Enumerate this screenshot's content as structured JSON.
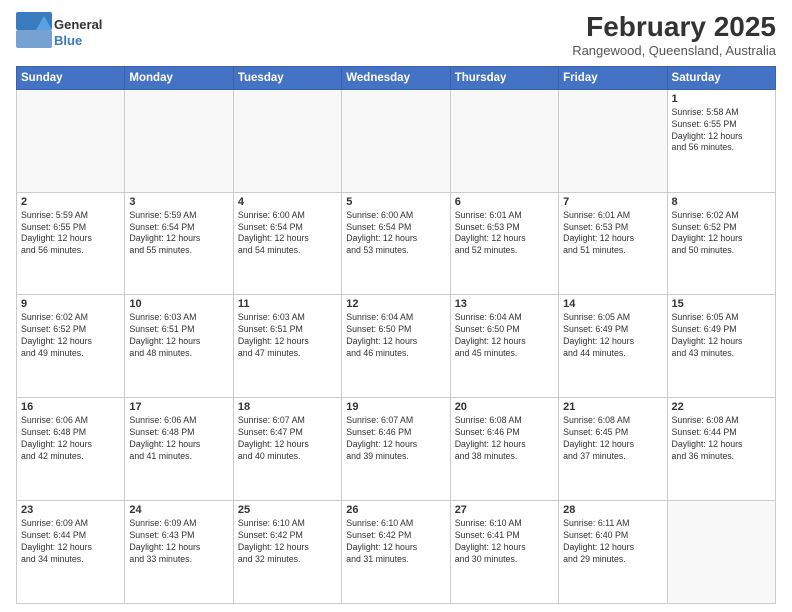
{
  "logo": {
    "general": "General",
    "blue": "Blue"
  },
  "header": {
    "month": "February 2025",
    "location": "Rangewood, Queensland, Australia"
  },
  "days_of_week": [
    "Sunday",
    "Monday",
    "Tuesday",
    "Wednesday",
    "Thursday",
    "Friday",
    "Saturday"
  ],
  "weeks": [
    [
      {
        "day": "",
        "info": ""
      },
      {
        "day": "",
        "info": ""
      },
      {
        "day": "",
        "info": ""
      },
      {
        "day": "",
        "info": ""
      },
      {
        "day": "",
        "info": ""
      },
      {
        "day": "",
        "info": ""
      },
      {
        "day": "1",
        "info": "Sunrise: 5:58 AM\nSunset: 6:55 PM\nDaylight: 12 hours\nand 56 minutes."
      }
    ],
    [
      {
        "day": "2",
        "info": "Sunrise: 5:59 AM\nSunset: 6:55 PM\nDaylight: 12 hours\nand 56 minutes."
      },
      {
        "day": "3",
        "info": "Sunrise: 5:59 AM\nSunset: 6:54 PM\nDaylight: 12 hours\nand 55 minutes."
      },
      {
        "day": "4",
        "info": "Sunrise: 6:00 AM\nSunset: 6:54 PM\nDaylight: 12 hours\nand 54 minutes."
      },
      {
        "day": "5",
        "info": "Sunrise: 6:00 AM\nSunset: 6:54 PM\nDaylight: 12 hours\nand 53 minutes."
      },
      {
        "day": "6",
        "info": "Sunrise: 6:01 AM\nSunset: 6:53 PM\nDaylight: 12 hours\nand 52 minutes."
      },
      {
        "day": "7",
        "info": "Sunrise: 6:01 AM\nSunset: 6:53 PM\nDaylight: 12 hours\nand 51 minutes."
      },
      {
        "day": "8",
        "info": "Sunrise: 6:02 AM\nSunset: 6:52 PM\nDaylight: 12 hours\nand 50 minutes."
      }
    ],
    [
      {
        "day": "9",
        "info": "Sunrise: 6:02 AM\nSunset: 6:52 PM\nDaylight: 12 hours\nand 49 minutes."
      },
      {
        "day": "10",
        "info": "Sunrise: 6:03 AM\nSunset: 6:51 PM\nDaylight: 12 hours\nand 48 minutes."
      },
      {
        "day": "11",
        "info": "Sunrise: 6:03 AM\nSunset: 6:51 PM\nDaylight: 12 hours\nand 47 minutes."
      },
      {
        "day": "12",
        "info": "Sunrise: 6:04 AM\nSunset: 6:50 PM\nDaylight: 12 hours\nand 46 minutes."
      },
      {
        "day": "13",
        "info": "Sunrise: 6:04 AM\nSunset: 6:50 PM\nDaylight: 12 hours\nand 45 minutes."
      },
      {
        "day": "14",
        "info": "Sunrise: 6:05 AM\nSunset: 6:49 PM\nDaylight: 12 hours\nand 44 minutes."
      },
      {
        "day": "15",
        "info": "Sunrise: 6:05 AM\nSunset: 6:49 PM\nDaylight: 12 hours\nand 43 minutes."
      }
    ],
    [
      {
        "day": "16",
        "info": "Sunrise: 6:06 AM\nSunset: 6:48 PM\nDaylight: 12 hours\nand 42 minutes."
      },
      {
        "day": "17",
        "info": "Sunrise: 6:06 AM\nSunset: 6:48 PM\nDaylight: 12 hours\nand 41 minutes."
      },
      {
        "day": "18",
        "info": "Sunrise: 6:07 AM\nSunset: 6:47 PM\nDaylight: 12 hours\nand 40 minutes."
      },
      {
        "day": "19",
        "info": "Sunrise: 6:07 AM\nSunset: 6:46 PM\nDaylight: 12 hours\nand 39 minutes."
      },
      {
        "day": "20",
        "info": "Sunrise: 6:08 AM\nSunset: 6:46 PM\nDaylight: 12 hours\nand 38 minutes."
      },
      {
        "day": "21",
        "info": "Sunrise: 6:08 AM\nSunset: 6:45 PM\nDaylight: 12 hours\nand 37 minutes."
      },
      {
        "day": "22",
        "info": "Sunrise: 6:08 AM\nSunset: 6:44 PM\nDaylight: 12 hours\nand 36 minutes."
      }
    ],
    [
      {
        "day": "23",
        "info": "Sunrise: 6:09 AM\nSunset: 6:44 PM\nDaylight: 12 hours\nand 34 minutes."
      },
      {
        "day": "24",
        "info": "Sunrise: 6:09 AM\nSunset: 6:43 PM\nDaylight: 12 hours\nand 33 minutes."
      },
      {
        "day": "25",
        "info": "Sunrise: 6:10 AM\nSunset: 6:42 PM\nDaylight: 12 hours\nand 32 minutes."
      },
      {
        "day": "26",
        "info": "Sunrise: 6:10 AM\nSunset: 6:42 PM\nDaylight: 12 hours\nand 31 minutes."
      },
      {
        "day": "27",
        "info": "Sunrise: 6:10 AM\nSunset: 6:41 PM\nDaylight: 12 hours\nand 30 minutes."
      },
      {
        "day": "28",
        "info": "Sunrise: 6:11 AM\nSunset: 6:40 PM\nDaylight: 12 hours\nand 29 minutes."
      },
      {
        "day": "",
        "info": ""
      }
    ]
  ]
}
